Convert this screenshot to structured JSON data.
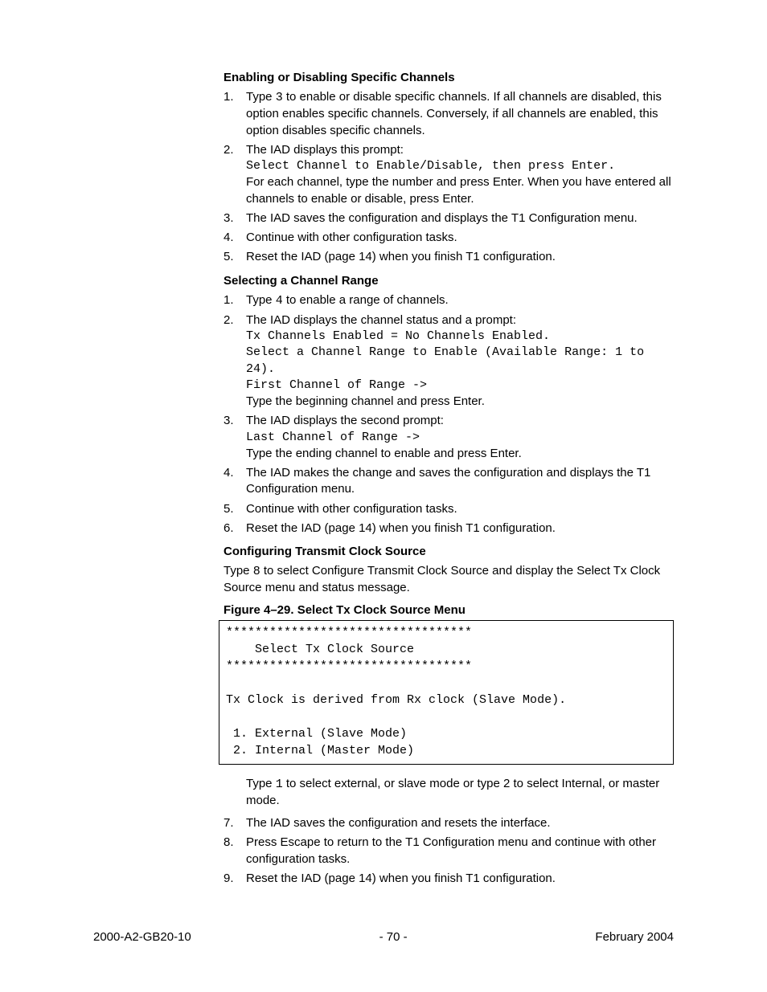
{
  "section1": {
    "heading": "Enabling or Disabling Specific Channels",
    "items": [
      {
        "num": "1.",
        "pre": "Type ",
        "mono": "3",
        "post": " to enable or disable specific channels. If all channels are disabled, this option enables specific channels. Conversely, if all channels are enabled, this option disables specific channels."
      },
      {
        "num": "2.",
        "text": "The IAD displays this prompt:",
        "code": "Select Channel to Enable/Disable, then press Enter.",
        "after": "For each channel, type the number and press Enter. When you have entered all channels to enable or disable, press Enter."
      },
      {
        "num": "3.",
        "text": "The IAD saves the configuration and displays the T1 Configuration menu."
      },
      {
        "num": "4.",
        "text": "Continue with other configuration tasks."
      },
      {
        "num": "5.",
        "text": "Reset the IAD (page 14) when you finish T1 configuration."
      }
    ]
  },
  "section2": {
    "heading": "Selecting a Channel Range",
    "items": [
      {
        "num": "1.",
        "pre": "Type ",
        "mono": "4",
        "post": " to enable a range of channels."
      },
      {
        "num": "2.",
        "text": "The IAD displays the channel status and a prompt:",
        "code": "Tx Channels Enabled = No Channels Enabled.\nSelect a Channel Range to Enable (Available Range: 1 to 24).\nFirst Channel of Range ->",
        "after": "Type the beginning channel and press Enter."
      },
      {
        "num": "3.",
        "text": "The IAD displays the second prompt:",
        "code": "Last Channel of Range ->",
        "after": "Type the ending channel to enable and press Enter."
      },
      {
        "num": "4.",
        "text": "The IAD makes the change and saves the configuration and displays the T1 Configuration menu."
      },
      {
        "num": "5.",
        "text": "Continue with other configuration tasks."
      },
      {
        "num": "6.",
        "text": "Reset the IAD (page 14) when you finish T1 configuration."
      }
    ]
  },
  "section3": {
    "heading": "Configuring Transmit Clock Source",
    "intro_pre": "Type ",
    "intro_mono": "8",
    "intro_post": " to select Configure Transmit Clock Source and display the Select Tx Clock Source menu and status message.",
    "fig_caption": "Figure 4–29.  Select Tx Clock Source Menu",
    "menu": "**********************************\n    Select Tx Clock Source\n**********************************\n\nTx Clock is derived from Rx clock (Slave Mode).\n\n 1. External (Slave Mode)\n 2. Internal (Master Mode)",
    "after_menu_pre": "Type ",
    "after_menu_mono": "1",
    "after_menu_post": " to select external, or slave mode or type 2 to select Internal, or master mode.",
    "items": [
      {
        "num": "7.",
        "text": "The IAD saves the configuration and resets the interface."
      },
      {
        "num": "8.",
        "text": "Press Escape to return to the T1 Configuration menu and continue with other configuration tasks."
      },
      {
        "num": "9.",
        "text": "Reset the IAD (page 14) when you finish T1 configuration."
      }
    ]
  },
  "footer": {
    "left": "2000-A2-GB20-10",
    "center": "- 70 -",
    "right": "February 2004"
  }
}
